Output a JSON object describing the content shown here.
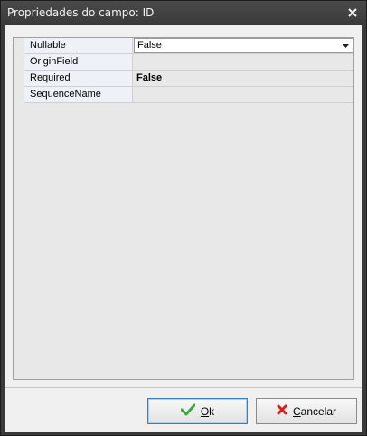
{
  "window": {
    "title": "Propriedades do campo: ID"
  },
  "grid": {
    "rows": [
      {
        "name": "Nullable",
        "value": "False",
        "bold": false,
        "selected": true
      },
      {
        "name": "OriginField",
        "value": "",
        "bold": false,
        "selected": false
      },
      {
        "name": "Required",
        "value": "False",
        "bold": true,
        "selected": false
      },
      {
        "name": "SequenceName",
        "value": "",
        "bold": false,
        "selected": false
      }
    ]
  },
  "buttons": {
    "ok_label_mnemonic": "O",
    "ok_label_rest": "k",
    "cancel_label_mnemonic": "C",
    "cancel_label_rest": "ancelar"
  },
  "icons": {
    "ok": "checkmark-icon",
    "cancel": "x-icon",
    "close": "close-icon",
    "dropdown": "chevron-down-icon"
  },
  "colors": {
    "ok_check": "#3aa83a",
    "cancel_x": "#d42020"
  }
}
